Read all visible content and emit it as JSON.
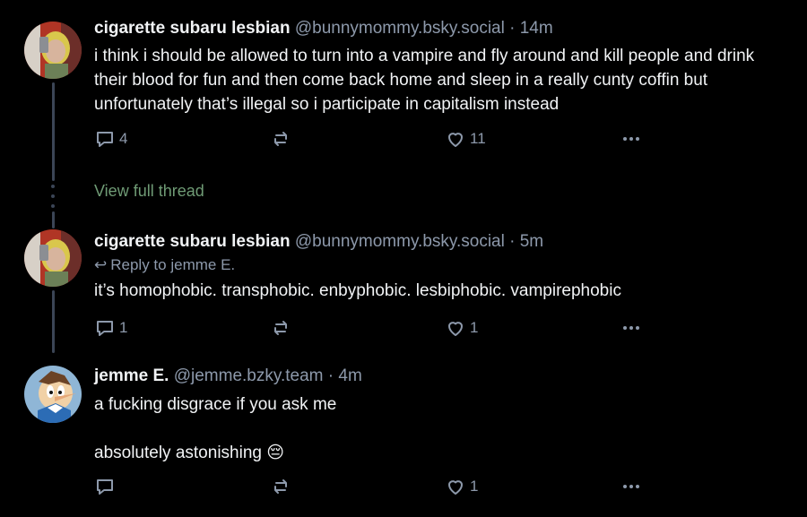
{
  "posts": [
    {
      "author_name": "cigarette subaru lesbian",
      "handle": "@bunnymommy.bsky.social",
      "time": "14m",
      "text": "i think i should be allowed to turn into a vampire and fly around and kill people and drink their blood for fun and then come back home and sleep in a really cunty coffin but unfortunately that’s illegal so i participate in capitalism instead",
      "reply_count": "4",
      "repost_count": "",
      "like_count": "11"
    },
    {
      "author_name": "cigarette subaru lesbian",
      "handle": "@bunnymommy.bsky.social",
      "time": "5m",
      "reply_to": "Reply to jemme E.",
      "text": "it’s homophobic. transphobic. enbyphobic. lesbiphobic. vampirephobic",
      "reply_count": "1",
      "repost_count": "",
      "like_count": "1"
    },
    {
      "author_name": "jemme E.",
      "handle": "@jemme.bzky.team",
      "time": "4m",
      "text": "a fucking disgrace if you ask me\n\nabsolutely astonishing 😔",
      "reply_count": "",
      "repost_count": "",
      "like_count": "1"
    }
  ],
  "view_full_thread": "View full thread",
  "separator": "·",
  "icons": {
    "reply": "reply-icon",
    "repost": "repost-icon",
    "like": "heart-icon",
    "more": "more-icon"
  },
  "colors": {
    "background": "#000000",
    "text": "#f1f3f5",
    "muted": "#8d99ab",
    "thread_line": "#3b4556",
    "view_thread": "#6f9b75"
  }
}
